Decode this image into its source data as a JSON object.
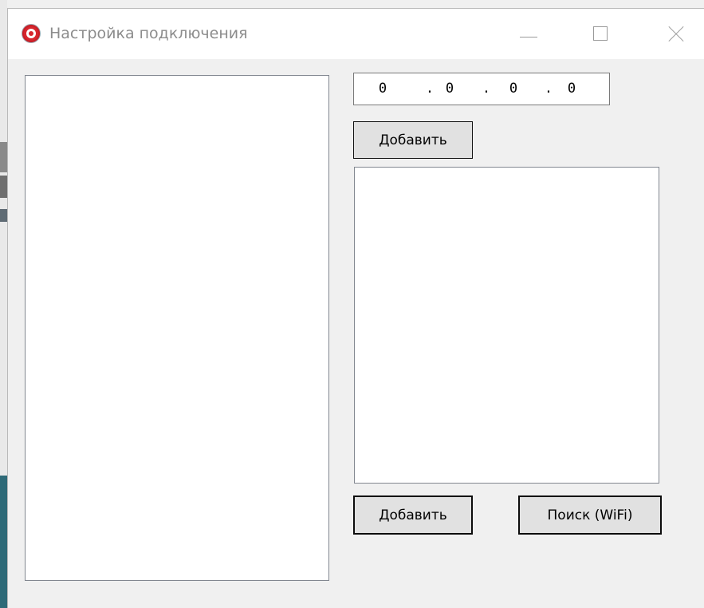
{
  "window": {
    "title": "Настройка подключения",
    "icon": "app-logo-icon",
    "controls": {
      "minimize": "minimize-icon",
      "maximize": "maximize-icon",
      "close": "close-icon"
    }
  },
  "ip_address": {
    "octet1": "0",
    "octet2": "0",
    "octet3": "0",
    "octet4": "0",
    "separator": "."
  },
  "buttons": {
    "add_ip_label": "Добавить",
    "add_label": "Добавить",
    "search_wifi_label": "Поиск (WiFi)"
  },
  "lists": {
    "left_items": [],
    "right_items": []
  },
  "colors": {
    "window_bg": "#f0f0f0",
    "titlebar_bg": "#ffffff",
    "accent_icon": "#d7262e"
  }
}
